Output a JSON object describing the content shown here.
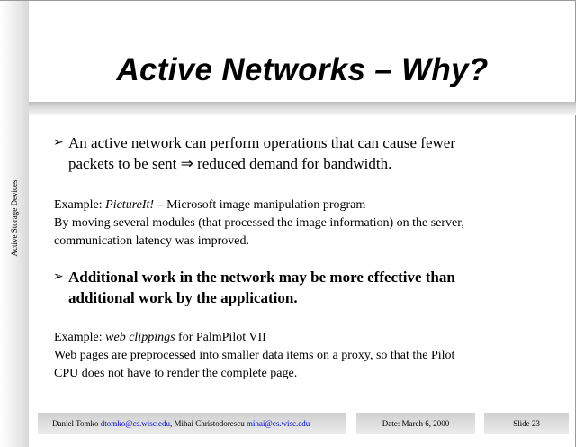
{
  "sidebar": {
    "label": "Active Storage Devices"
  },
  "title": "Active Networks – Why?",
  "bullets": [
    {
      "arrow": "➢",
      "line1": "An active network can perform operations that can cause fewer",
      "line2": "packets to be sent ⇒ reduced demand for bandwidth."
    },
    {
      "arrow": "➢",
      "line1": "Additional work in the network may be more effective than",
      "line2": "additional work by the application."
    }
  ],
  "examples": [
    {
      "prefix": "Example: ",
      "italic": "PictureIt!",
      "suffix": " – Microsoft image manipulation program",
      "line2": "By moving several modules (that processed the image information) on the server,",
      "line3": "communication latency was improved."
    },
    {
      "prefix": "Example: ",
      "italic": "web clippings",
      "suffix": " for PalmPilot VII",
      "line2": "Web pages are preprocessed into smaller data items on a proxy, so that the Pilot",
      "line3": "CPU does not have to render the complete page."
    }
  ],
  "footer": {
    "author1": "Daniel Tomko ",
    "email1": "dtomko@cs.wisc.edu",
    "sep": ", Mihai Christodorescu ",
    "email2": "mihai@cs.wisc.edu",
    "date": "Date: March 6, 2000",
    "slide": "Slide 23"
  }
}
